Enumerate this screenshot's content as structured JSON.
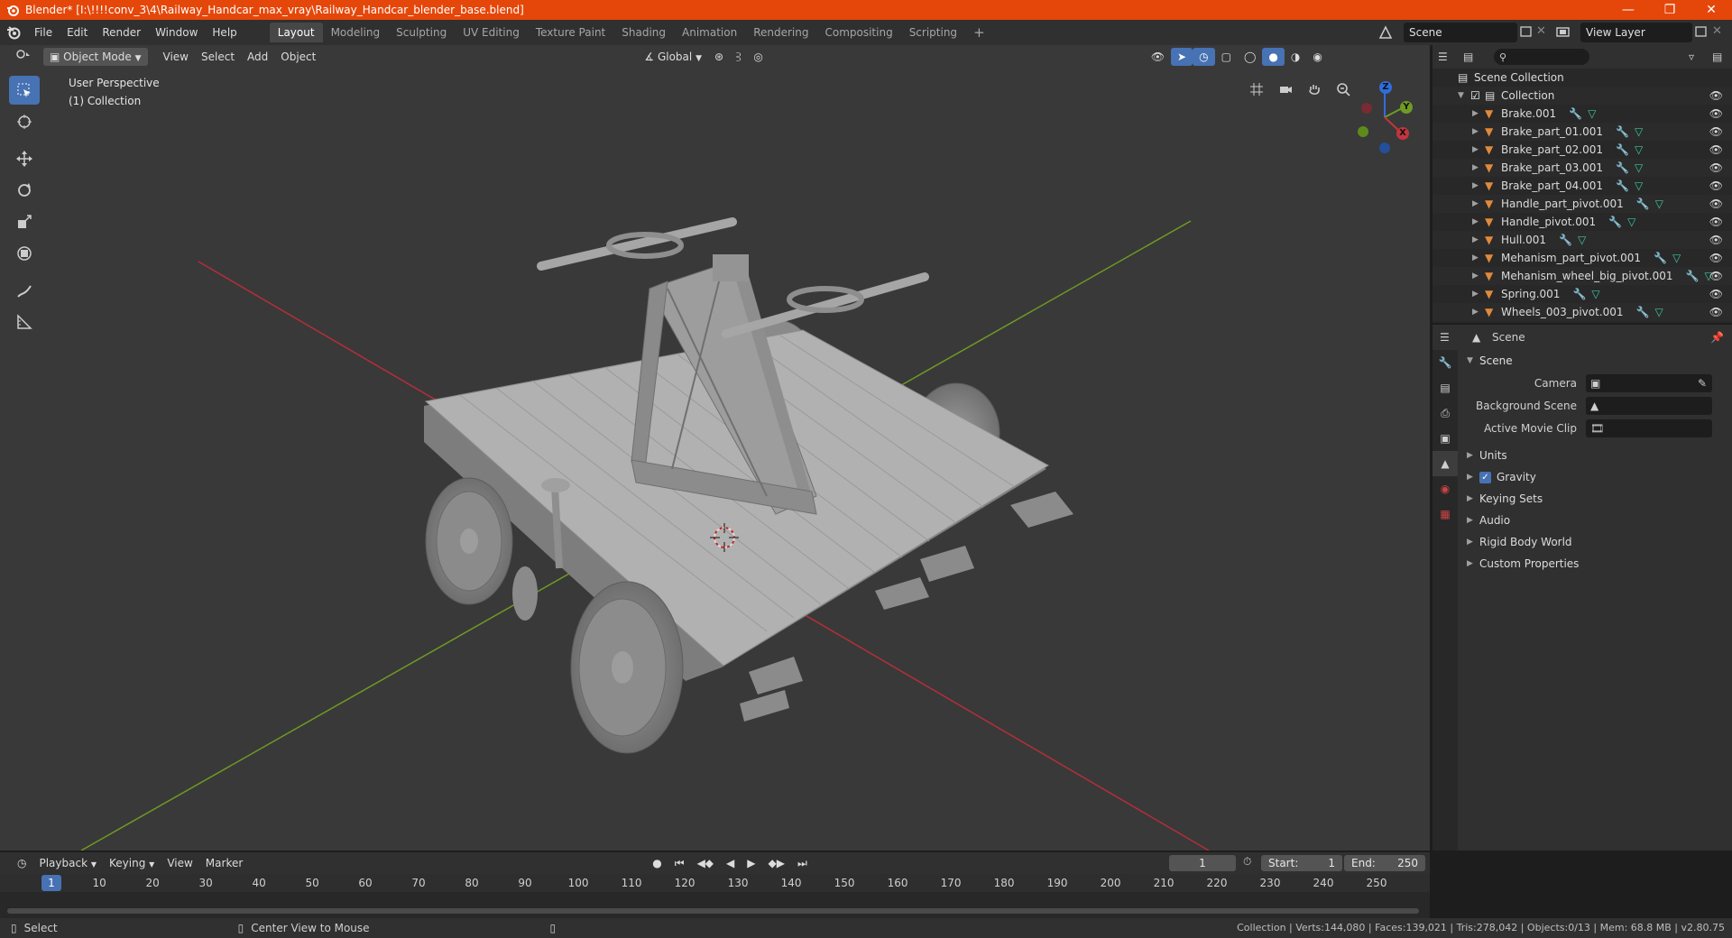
{
  "window": {
    "title": "Blender* [I:\\!!!!conv_3\\4\\Railway_Handcar_max_vray\\Railway_Handcar_blender_base.blend]"
  },
  "menu": [
    "File",
    "Edit",
    "Render",
    "Window",
    "Help"
  ],
  "workspaces": [
    "Layout",
    "Modeling",
    "Sculpting",
    "UV Editing",
    "Texture Paint",
    "Shading",
    "Animation",
    "Rendering",
    "Compositing",
    "Scripting"
  ],
  "active_workspace": "Layout",
  "scene_name": "Scene",
  "view_layer": "View Layer",
  "viewport": {
    "mode": "Object Mode",
    "menus": [
      "View",
      "Select",
      "Add",
      "Object"
    ],
    "transform_orientation": "Global",
    "perspective_label": "User Perspective",
    "collection_label": "(1) Collection",
    "gizmo": {
      "x": "X",
      "y": "Y",
      "z": "Z"
    }
  },
  "outliner": {
    "root": "Scene Collection",
    "collection": "Collection",
    "items": [
      "Brake.001",
      "Brake_part_01.001",
      "Brake_part_02.001",
      "Brake_part_03.001",
      "Brake_part_04.001",
      "Handle_part_pivot.001",
      "Handle_pivot.001",
      "Hull.001",
      "Mehanism_part_pivot.001",
      "Mehanism_wheel_big_pivot.001",
      "Spring.001",
      "Wheels_003_pivot.001"
    ]
  },
  "properties": {
    "header": "Scene",
    "section": "Scene",
    "rows": [
      {
        "label": "Camera"
      },
      {
        "label": "Background Scene"
      },
      {
        "label": "Active Movie Clip"
      }
    ],
    "subsections": [
      "Units",
      "Gravity",
      "Keying Sets",
      "Audio",
      "Rigid Body World",
      "Custom Properties"
    ],
    "gravity_enabled": true
  },
  "timeline": {
    "menus": [
      "Playback",
      "Keying",
      "View",
      "Marker"
    ],
    "current_frame": "1",
    "start_label": "Start:",
    "start": "1",
    "end_label": "End:",
    "end": "250",
    "ruler": [
      "1",
      "10",
      "20",
      "30",
      "40",
      "50",
      "60",
      "70",
      "80",
      "90",
      "100",
      "110",
      "120",
      "130",
      "140",
      "150",
      "160",
      "170",
      "180",
      "190",
      "200",
      "210",
      "220",
      "230",
      "240",
      "250"
    ]
  },
  "statusbar": {
    "left_action": "Select",
    "middle_action": "Center View to Mouse",
    "stats": "Collection | Verts:144,080 | Faces:139,021 | Tris:278,042 | Objects:0/13 | Mem: 68.8 MB | v2.80.75"
  },
  "colors": {
    "titlebar": "#e5470a",
    "accent": "#4772b3",
    "x_axis": "#c2353f",
    "y_axis": "#6f9a24",
    "z_axis": "#2f6ddc"
  }
}
